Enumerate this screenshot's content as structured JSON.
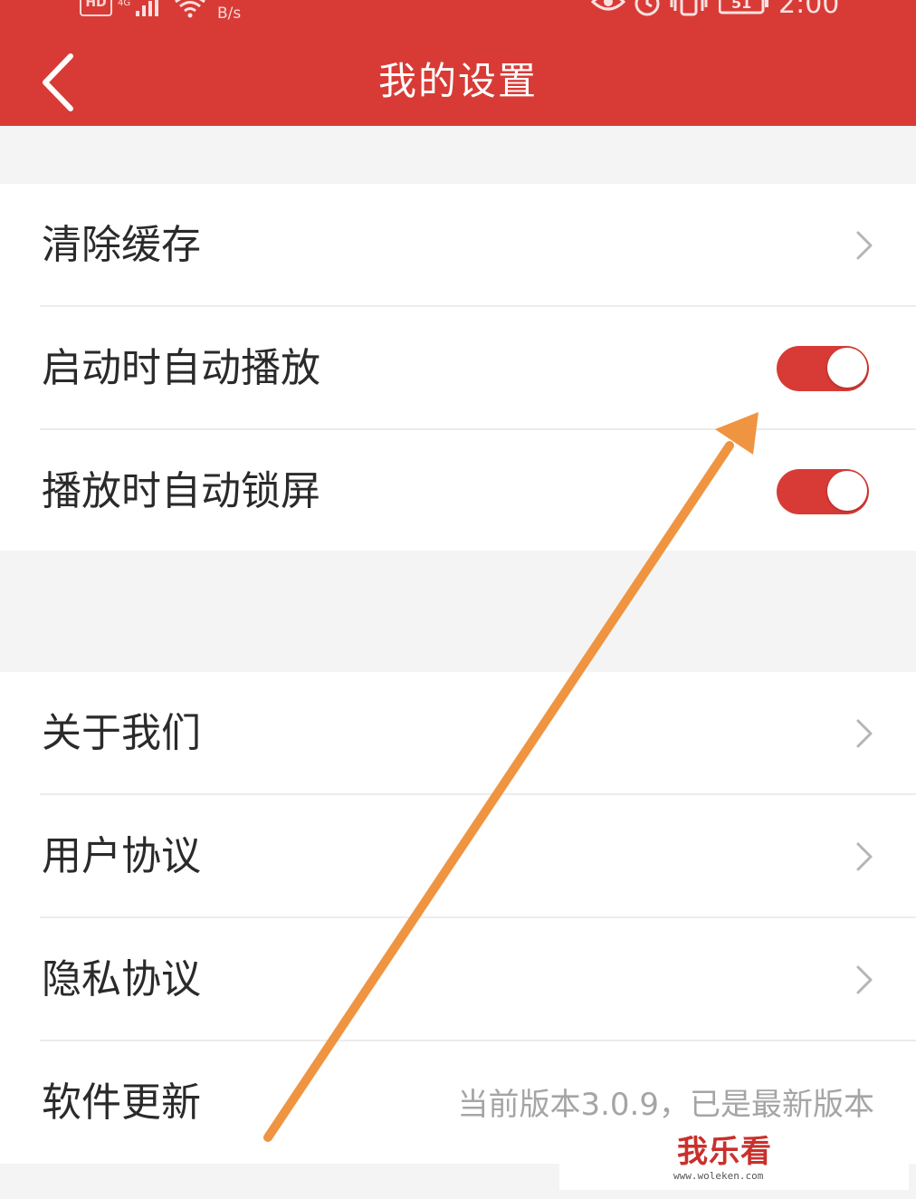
{
  "status_bar": {
    "hd_label": "HD",
    "net_speed": "B/s",
    "battery": "51",
    "time": "2:00"
  },
  "header": {
    "title": "我的设置"
  },
  "groups": [
    {
      "rows": [
        {
          "label": "清除缓存",
          "control": "chevron"
        },
        {
          "label": "启动时自动播放",
          "control": "toggle",
          "on": true
        },
        {
          "label": "播放时自动锁屏",
          "control": "toggle",
          "on": true
        }
      ]
    },
    {
      "rows": [
        {
          "label": "关于我们",
          "control": "chevron"
        },
        {
          "label": "用户协议",
          "control": "chevron"
        },
        {
          "label": "隐私协议",
          "control": "chevron"
        },
        {
          "label": "软件更新",
          "control": "text",
          "value": "当前版本3.0.9，已是最新版本"
        }
      ]
    }
  ],
  "watermark": {
    "logo": "我乐看",
    "url": "www.woleken.com"
  },
  "colors": {
    "header": "#d83b36",
    "toggle_on": "#d83b36",
    "annotation_arrow": "#ef9441",
    "background": "#f4f4f4"
  },
  "icons": {
    "back": "chevron-left-icon",
    "row_chevron": "chevron-right-icon",
    "status": [
      "hd-icon",
      "signal-icon",
      "wifi-icon",
      "eye-icon",
      "alarm-icon",
      "vibrate-icon",
      "battery-icon"
    ]
  }
}
